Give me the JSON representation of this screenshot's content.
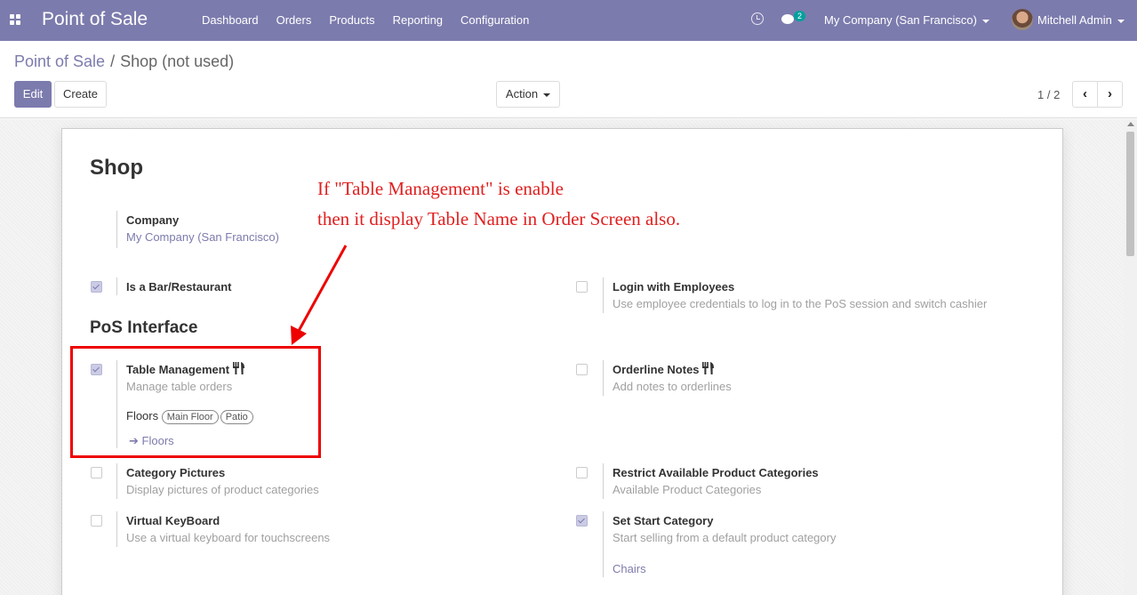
{
  "navbar": {
    "brand": "Point of Sale",
    "menu": [
      "Dashboard",
      "Orders",
      "Products",
      "Reporting",
      "Configuration"
    ],
    "chat_badge": "2",
    "company": "My Company (San Francisco)",
    "user": "Mitchell Admin",
    "bg_color": "#7c7bad"
  },
  "control": {
    "breadcrumb_parent": "Point of Sale",
    "breadcrumb_sep": "/",
    "breadcrumb_current": "Shop (not used)",
    "edit_label": "Edit",
    "create_label": "Create",
    "action_label": "Action",
    "pager": "1 / 2"
  },
  "form": {
    "title": "Shop",
    "company_label": "Company",
    "company_value": "My Company (San Francisco)",
    "bar_label": "Is a Bar/Restaurant",
    "login_label": "Login with Employees",
    "login_desc": "Use employee credentials to log in to the PoS session and switch cashier",
    "pos_section": "PoS Interface",
    "table_label": "Table Management",
    "table_desc": "Manage table orders",
    "floors_label": "Floors",
    "floor_tags": [
      "Main Floor",
      "Patio"
    ],
    "floors_link": "Floors",
    "orderline_label": "Orderline Notes",
    "orderline_desc": "Add notes to orderlines",
    "catpic_label": "Category Pictures",
    "catpic_desc": "Display pictures of product categories",
    "restrict_label": "Restrict Available Product Categories",
    "restrict_desc": "Available Product Categories",
    "vkb_label": "Virtual KeyBoard",
    "vkb_desc": "Use a virtual keyboard for touchscreens",
    "startcat_label": "Set Start Category",
    "startcat_desc": "Start selling from a default product category",
    "startcat_value": "Chairs"
  },
  "annotation": {
    "line1": "If \"Table Management\" is enable",
    "line2": "then it display Table Name in Order Screen also.",
    "color": "#e00000"
  }
}
